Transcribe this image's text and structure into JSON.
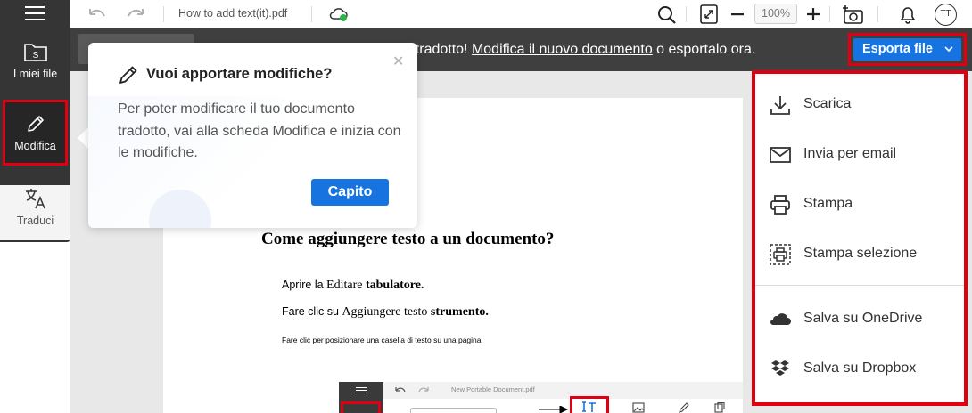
{
  "sidebar": {
    "items": [
      {
        "label": "I miei file",
        "icon": "folder-s-icon"
      },
      {
        "label": "Modifica",
        "icon": "pencil-icon",
        "active": true
      },
      {
        "label": "Traduci",
        "icon": "translate-icon"
      }
    ]
  },
  "toolbar": {
    "document_title": "How to add text(it).pdf",
    "zoom": "100%",
    "avatar_initials": "TT",
    "icons": [
      "undo-icon",
      "redo-icon",
      "cloud-sync-icon",
      "search-icon",
      "fit-page-icon",
      "zoom-out-icon",
      "zoom-in-icon",
      "camera-icon",
      "bell-icon"
    ]
  },
  "notice": {
    "text_start": "to tradotto! ",
    "link": "Modifica il nuovo documento",
    "text_end": " o esportalo ora."
  },
  "export": {
    "button_label": "Esporta file",
    "menu": [
      {
        "label": "Scarica",
        "icon": "download-icon"
      },
      {
        "label": "Invia per email",
        "icon": "email-icon"
      },
      {
        "label": "Stampa",
        "icon": "printer-icon"
      },
      {
        "label": "Stampa selezione",
        "icon": "print-selection-icon"
      },
      {
        "label": "Salva su OneDrive",
        "icon": "onedrive-icon"
      },
      {
        "label": "Salva su Dropbox",
        "icon": "dropbox-icon"
      }
    ]
  },
  "popover": {
    "title": "Vuoi apportare modifiche?",
    "body": "Per poter modificare il tuo documento tradotto, vai alla scheda Modifica e inizia con le modifiche.",
    "button": "Capito"
  },
  "document": {
    "heading": "Come aggiungere testo a un documento?",
    "line1": {
      "a": "Aprire la ",
      "b": "Editare ",
      "c": "tabulatore."
    },
    "line2": {
      "a": "Fare clic su ",
      "b": "Aggiungere testo ",
      "c": "strumento."
    },
    "line3": "Fare clic per posizionare una casella di testo su una pagina.",
    "embedded_title": "New Portable Document.pdf"
  },
  "colors": {
    "accent": "#1673e0",
    "highlight": "#e0000f",
    "rail": "#353535",
    "notice": "#3f3f3f"
  }
}
